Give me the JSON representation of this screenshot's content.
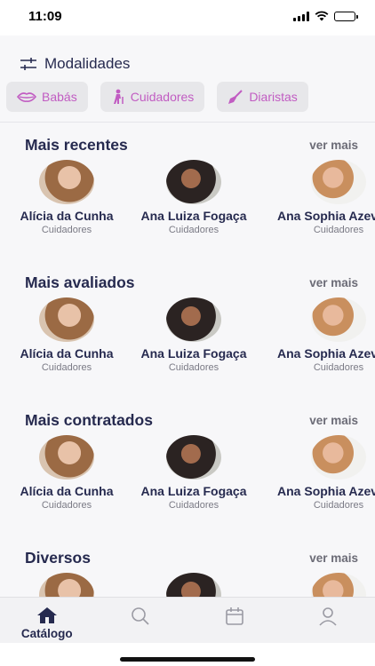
{
  "status_bar": {
    "time": "11:09"
  },
  "modalidades": {
    "title": "Modalidades",
    "chips": [
      {
        "label": "Babás",
        "icon": "lips-icon"
      },
      {
        "label": "Cuidadores",
        "icon": "elderly-person-icon"
      },
      {
        "label": "Diaristas",
        "icon": "broom-icon"
      }
    ]
  },
  "sections": [
    {
      "title": "Mais recentes",
      "see_more": "ver mais",
      "cards": [
        {
          "name": "Alícia da Cunha",
          "role": "Cuidadores"
        },
        {
          "name": "Ana Luiza Fogaça",
          "role": "Cuidadores"
        },
        {
          "name": "Ana Sophia Azevedo",
          "role": "Cuidadores"
        }
      ]
    },
    {
      "title": "Mais avaliados",
      "see_more": "ver mais",
      "cards": [
        {
          "name": "Alícia da Cunha",
          "role": "Cuidadores"
        },
        {
          "name": "Ana Luiza Fogaça",
          "role": "Cuidadores"
        },
        {
          "name": "Ana Sophia Azevedo",
          "role": "Cuidadores"
        }
      ]
    },
    {
      "title": "Mais contratados",
      "see_more": "ver mais",
      "cards": [
        {
          "name": "Alícia da Cunha",
          "role": "Cuidadores"
        },
        {
          "name": "Ana Luiza Fogaça",
          "role": "Cuidadores"
        },
        {
          "name": "Ana Sophia Azevedo",
          "role": "Cuidadores"
        }
      ]
    },
    {
      "title": "Diversos",
      "see_more": "ver mais",
      "cards": [
        {
          "name": "",
          "role": ""
        },
        {
          "name": "",
          "role": ""
        },
        {
          "name": "",
          "role": ""
        }
      ]
    }
  ],
  "tab_bar": {
    "tabs": [
      {
        "label": "Catálogo",
        "icon": "home-icon",
        "active": true
      },
      {
        "label": "",
        "icon": "search-icon",
        "active": false
      },
      {
        "label": "",
        "icon": "calendar-icon",
        "active": false
      },
      {
        "label": "",
        "icon": "profile-icon",
        "active": false
      }
    ]
  },
  "colors": {
    "accent": "#c15cc2",
    "primary_text": "#262a4f",
    "muted_text": "#7a7a85"
  }
}
